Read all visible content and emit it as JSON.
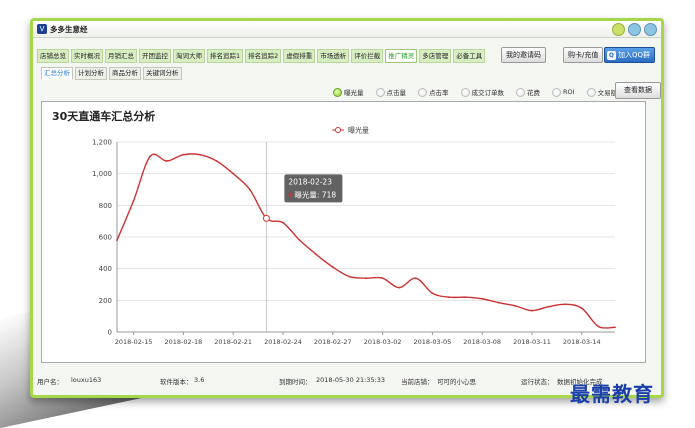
{
  "app": {
    "logo_letter": "V",
    "title": "多多生意经"
  },
  "nav": {
    "tabs": [
      "店铺总览",
      "实时概况",
      "月销汇总",
      "开团监控",
      "淘词大师",
      "排名追踪1",
      "排名追踪2",
      "虚假排重",
      "市场透析",
      "评价拦截",
      "推广精灵",
      "多店管理",
      "必备工具"
    ],
    "active_index": 10
  },
  "toolbar": {
    "invite_label": "我的邀请码",
    "recharge_label": "购卡/充值",
    "qq_icon": "qq-icon",
    "qq_label": "加入QQ群"
  },
  "subtabs": {
    "items": [
      "汇总分析",
      "计划分析",
      "商品分析",
      "关键词分析"
    ],
    "active_index": 0
  },
  "legend": {
    "items": [
      {
        "label": "曝光量",
        "on": true
      },
      {
        "label": "点击量",
        "on": false
      },
      {
        "label": "点击率",
        "on": false
      },
      {
        "label": "成交订单数",
        "on": false
      },
      {
        "label": "花费",
        "on": false
      },
      {
        "label": "ROI",
        "on": false
      },
      {
        "label": "文易额",
        "on": false
      }
    ]
  },
  "view_button_label": "查看数据",
  "chart_data": {
    "type": "line",
    "title": "30天直通车汇总分析",
    "series": [
      {
        "name": "曝光量",
        "color": "#cc3333",
        "values": [
          580,
          830,
          1110,
          1080,
          1120,
          1120,
          1080,
          1000,
          900,
          718,
          690,
          580,
          490,
          410,
          350,
          340,
          340,
          280,
          340,
          245,
          220,
          220,
          210,
          185,
          165,
          135,
          160,
          175,
          150,
          35,
          30
        ]
      }
    ],
    "x": [
      "2018-02-14",
      "2018-02-15",
      "2018-02-16",
      "2018-02-17",
      "2018-02-18",
      "2018-02-19",
      "2018-02-20",
      "2018-02-21",
      "2018-02-22",
      "2018-02-23",
      "2018-02-24",
      "2018-02-25",
      "2018-02-26",
      "2018-02-27",
      "2018-02-28",
      "2018-03-01",
      "2018-03-02",
      "2018-03-03",
      "2018-03-04",
      "2018-03-05",
      "2018-03-06",
      "2018-03-07",
      "2018-03-08",
      "2018-03-09",
      "2018-03-10",
      "2018-03-11",
      "2018-03-12",
      "2018-03-13",
      "2018-03-14",
      "2018-03-15",
      "2018-03-16"
    ],
    "x_tick_labels": [
      "2018-02-15",
      "2018-02-18",
      "2018-02-21",
      "2018-02-24",
      "2018-02-27",
      "2018-03-02",
      "2018-03-05",
      "2018-03-08",
      "2018-03-11",
      "2018-03-14"
    ],
    "y_ticks": [
      0,
      200,
      400,
      600,
      800,
      "1,000",
      "1,200"
    ],
    "ylim": [
      0,
      1200
    ],
    "legend_label": "曝光量",
    "tooltip": {
      "date": "2018-02-23",
      "series": "曝光量",
      "value": 718,
      "index": 9
    },
    "grid": "horizontal",
    "crosshair": true
  },
  "status": {
    "user_label": "用户名：",
    "user_value": "louxu163",
    "version_label": "软件版本：",
    "version_value": "3.6",
    "expire_label": "到期时间：",
    "expire_value": "2018-05-30 21:35:33",
    "shop_label": "当前店铺：",
    "shop_value": "可可的小心思",
    "run_label": "运行状态：",
    "run_value": "数据初始化完成"
  },
  "watermark": "最需教育"
}
